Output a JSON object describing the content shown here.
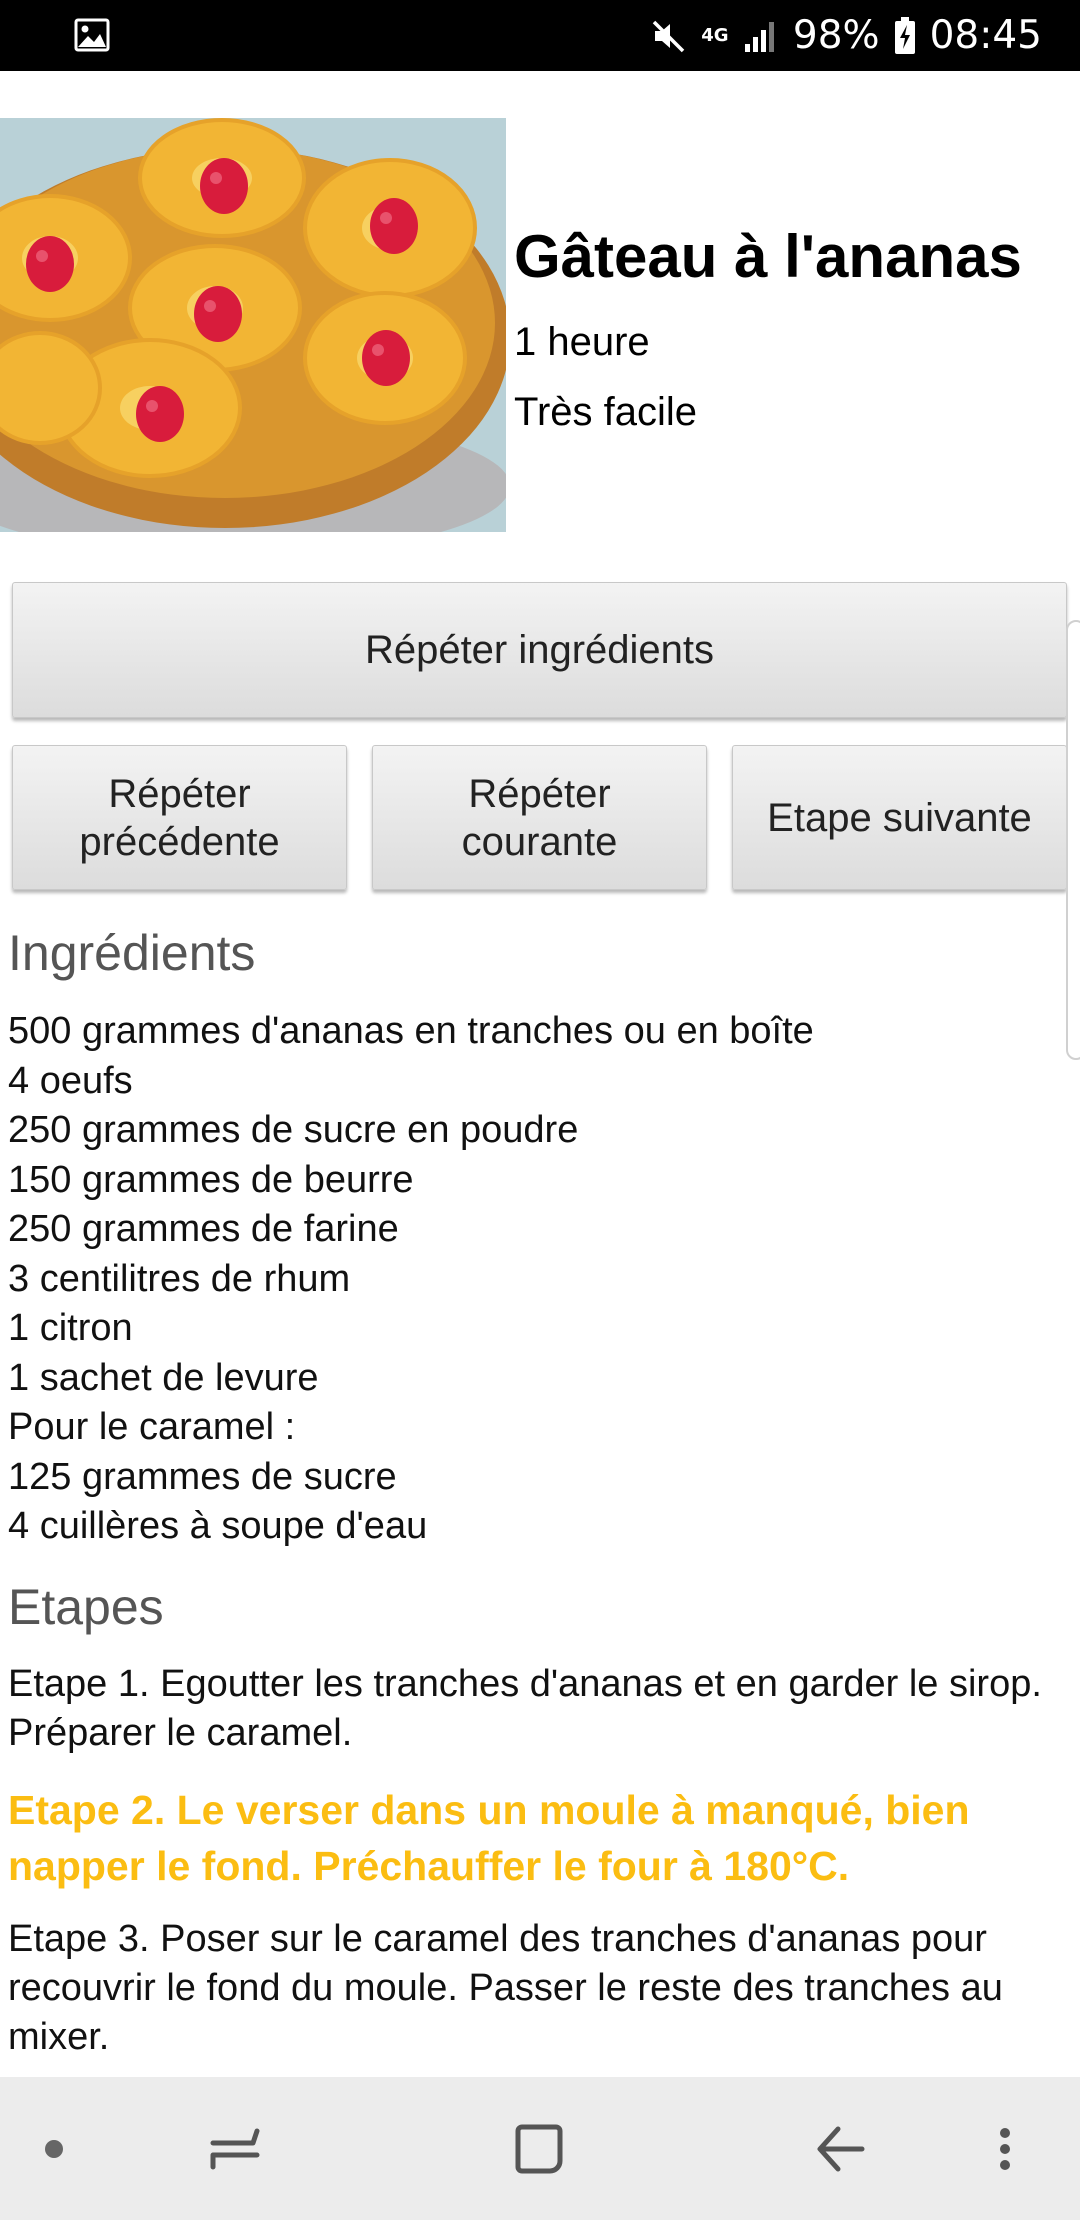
{
  "status_bar": {
    "network": "4G",
    "battery": "98%",
    "time": "08:45"
  },
  "recipe": {
    "title": "Gâteau à l'ananas",
    "duration": "1 heure",
    "difficulty": "Très facile"
  },
  "buttons": {
    "repeat_ingredients": "Répéter ingrédients",
    "repeat_previous": "Répéter précédente",
    "repeat_current": "Répéter courante",
    "next_step": "Etape suivante"
  },
  "ingredients": {
    "title": "Ingrédients",
    "items": [
      "500 grammes d'ananas en tranches ou en boîte",
      "4 oeufs",
      "250 grammes de sucre en poudre",
      "150 grammes de beurre",
      "250 grammes de farine",
      "3 centilitres de rhum",
      "1 citron",
      "1 sachet de levure",
      "Pour le caramel :",
      "125 grammes de sucre",
      "4 cuillères à soupe d'eau"
    ]
  },
  "steps": {
    "title": "Etapes",
    "items": [
      "Etape 1. Egoutter les tranches d'ananas et en garder le sirop. Préparer le caramel.",
      "Etape 2. Le verser dans un moule à manqué, bien napper le fond. Préchauffer le four à 180°C.",
      "Etape 3. Poser sur le caramel des tranches d'ananas pour recouvrir le fond du moule. Passer le reste des tranches au mixer."
    ],
    "highlight_color": "#fbbd12"
  },
  "nav_bar": {
    "icons": [
      "dot-icon",
      "recent-apps-icon",
      "home-icon",
      "back-icon",
      "more-icon"
    ]
  }
}
